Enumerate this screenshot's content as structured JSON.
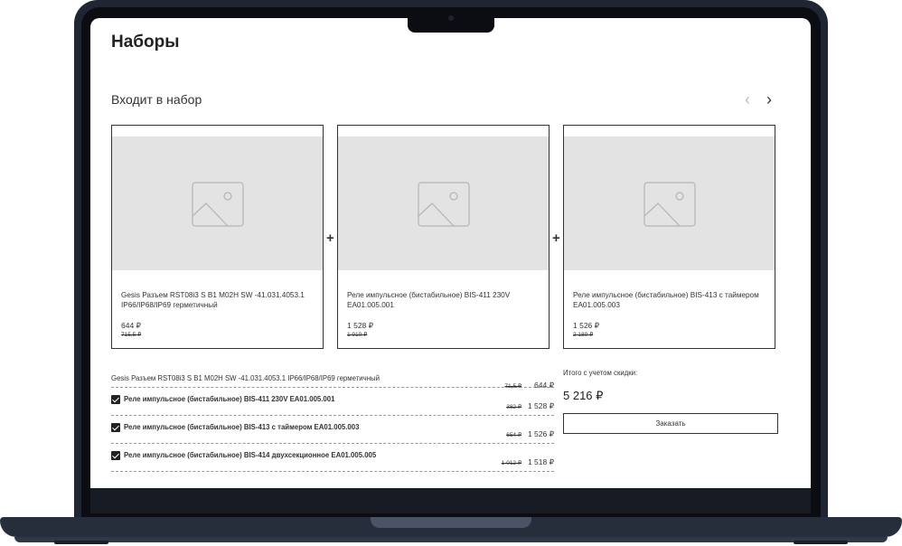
{
  "page": {
    "title": "Наборы",
    "section_title": "Входит в набор"
  },
  "carousel": {
    "prev_icon": "chevron-left-icon",
    "next_icon": "chevron-right-icon"
  },
  "cards": [
    {
      "name": "Gesis Разъем RST08i3 S B1 M02H SW -41.031.4053.1 IP66/IP68/IP69 герметичный",
      "price": "644 ₽",
      "old_price": "715,5 ₽"
    },
    {
      "name": "Реле импульсное (бистабильное) BIS-411 230V EA01.005.001",
      "price": "1 528 ₽",
      "old_price": "1 910 ₽"
    },
    {
      "name": "Реле импульсное (бистабильное) BIS-413 с таймером EA01.005.003",
      "price": "1 526 ₽",
      "old_price": "2 180 ₽"
    }
  ],
  "plus_sign": "+",
  "set_items": [
    {
      "name": "Gesis Разъем RST08i3 S B1 M02H SW -41.031.4053.1 IP66/IP68/IP69 герметичный",
      "old_price": "71,5 ₽",
      "price": "644 ₽",
      "checked": false
    },
    {
      "name": "Реле импульсное (бистабильное) BIS-411 230V EA01.005.001",
      "old_price": "382 ₽",
      "price": "1 528 ₽",
      "checked": true
    },
    {
      "name": "Реле импульсное (бистабильное) BIS-413 с таймером EA01.005.003",
      "old_price": "654 ₽",
      "price": "1 526 ₽",
      "checked": true
    },
    {
      "name": "Реле импульсное (бистабильное) BIS-414 двухсекционное EA01.005.005",
      "old_price": "1 012 ₽",
      "price": "1 518 ₽",
      "checked": true
    }
  ],
  "summary": {
    "total_label": "Итого с учетом скидки:",
    "total_value": "5 216 ₽",
    "order_button": "Заказать"
  }
}
